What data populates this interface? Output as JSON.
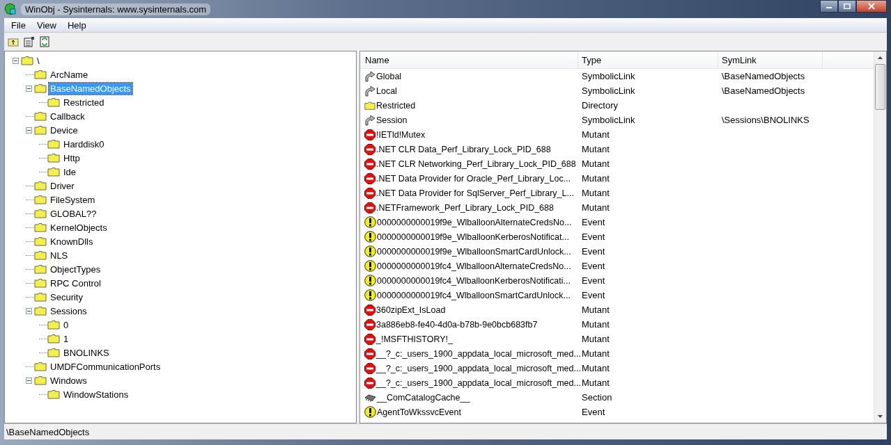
{
  "window": {
    "title": "WinObj - Sysinternals: www.sysinternals.com"
  },
  "menu": [
    "File",
    "View",
    "Help"
  ],
  "tree": {
    "label": "\\",
    "expanded": true,
    "selected": false,
    "children": [
      {
        "label": "ArcName",
        "selected": false
      },
      {
        "label": "BaseNamedObjects",
        "expanded": true,
        "selected": true,
        "children": [
          {
            "label": "Restricted",
            "selected": false
          }
        ]
      },
      {
        "label": "Callback",
        "selected": false
      },
      {
        "label": "Device",
        "expanded": true,
        "selected": false,
        "children": [
          {
            "label": "Harddisk0",
            "selected": false
          },
          {
            "label": "Http",
            "selected": false
          },
          {
            "label": "Ide",
            "selected": false
          }
        ]
      },
      {
        "label": "Driver",
        "selected": false
      },
      {
        "label": "FileSystem",
        "selected": false
      },
      {
        "label": "GLOBAL??",
        "selected": false
      },
      {
        "label": "KernelObjects",
        "selected": false
      },
      {
        "label": "KnownDlls",
        "selected": false
      },
      {
        "label": "NLS",
        "selected": false
      },
      {
        "label": "ObjectTypes",
        "selected": false
      },
      {
        "label": "RPC Control",
        "selected": false
      },
      {
        "label": "Security",
        "selected": false
      },
      {
        "label": "Sessions",
        "expanded": true,
        "selected": false,
        "children": [
          {
            "label": "0",
            "selected": false
          },
          {
            "label": "1",
            "selected": false
          },
          {
            "label": "BNOLINKS",
            "selected": false
          }
        ]
      },
      {
        "label": "UMDFCommunicationPorts",
        "selected": false
      },
      {
        "label": "Windows",
        "expanded": true,
        "selected": false,
        "children": [
          {
            "label": "WindowStations",
            "selected": false
          }
        ]
      }
    ]
  },
  "table": {
    "columns": [
      "Name",
      "Type",
      "SymLink"
    ],
    "rows": [
      {
        "kind": "symlink",
        "name": "Global",
        "type": "SymbolicLink",
        "symlink": "\\BaseNamedObjects"
      },
      {
        "kind": "symlink",
        "name": "Local",
        "type": "SymbolicLink",
        "symlink": "\\BaseNamedObjects"
      },
      {
        "kind": "directory",
        "name": "Restricted",
        "type": "Directory"
      },
      {
        "kind": "symlink",
        "name": "Session",
        "type": "SymbolicLink",
        "symlink": "\\Sessions\\BNOLINKS"
      },
      {
        "kind": "mutant",
        "name": "!IETld!Mutex",
        "type": "Mutant"
      },
      {
        "kind": "mutant",
        "name": ".NET CLR Data_Perf_Library_Lock_PID_688",
        "type": "Mutant"
      },
      {
        "kind": "mutant",
        "name": ".NET CLR Networking_Perf_Library_Lock_PID_688",
        "type": "Mutant"
      },
      {
        "kind": "mutant",
        "name": ".NET Data Provider for Oracle_Perf_Library_Loc...",
        "type": "Mutant"
      },
      {
        "kind": "mutant",
        "name": ".NET Data Provider for SqlServer_Perf_Library_L...",
        "type": "Mutant"
      },
      {
        "kind": "mutant",
        "name": ".NETFramework_Perf_Library_Lock_PID_688",
        "type": "Mutant"
      },
      {
        "kind": "event",
        "name": "0000000000019f9e_WlballoonAlternateCredsNo...",
        "type": "Event"
      },
      {
        "kind": "event",
        "name": "0000000000019f9e_WlballoonKerberosNotificat...",
        "type": "Event"
      },
      {
        "kind": "event",
        "name": "0000000000019f9e_WlballoonSmartCardUnlock...",
        "type": "Event"
      },
      {
        "kind": "event",
        "name": "0000000000019fc4_WlballoonAlternateCredsNo...",
        "type": "Event"
      },
      {
        "kind": "event",
        "name": "0000000000019fc4_WlballoonKerberosNotificati...",
        "type": "Event"
      },
      {
        "kind": "event",
        "name": "0000000000019fc4_WlballoonSmartCardUnlock...",
        "type": "Event"
      },
      {
        "kind": "mutant",
        "name": "360zipExt_IsLoad",
        "type": "Mutant"
      },
      {
        "kind": "mutant",
        "name": "3a886eb8-fe40-4d0a-b78b-9e0bcb683fb7",
        "type": "Mutant"
      },
      {
        "kind": "mutant",
        "name": "_!MSFTHISTORY!_",
        "type": "Mutant"
      },
      {
        "kind": "mutant",
        "name": "__?_c:_users_1900_appdata_local_microsoft_med...",
        "type": "Mutant"
      },
      {
        "kind": "mutant",
        "name": "__?_c:_users_1900_appdata_local_microsoft_med...",
        "type": "Mutant"
      },
      {
        "kind": "mutant",
        "name": "__?_c:_users_1900_appdata_local_microsoft_med...",
        "type": "Mutant"
      },
      {
        "kind": "section",
        "name": "__ComCatalogCache__",
        "type": "Section"
      },
      {
        "kind": "event",
        "name": "AgentToWkssvcEvent",
        "type": "Event"
      }
    ]
  },
  "status_bar": "\\BaseNamedObjects"
}
